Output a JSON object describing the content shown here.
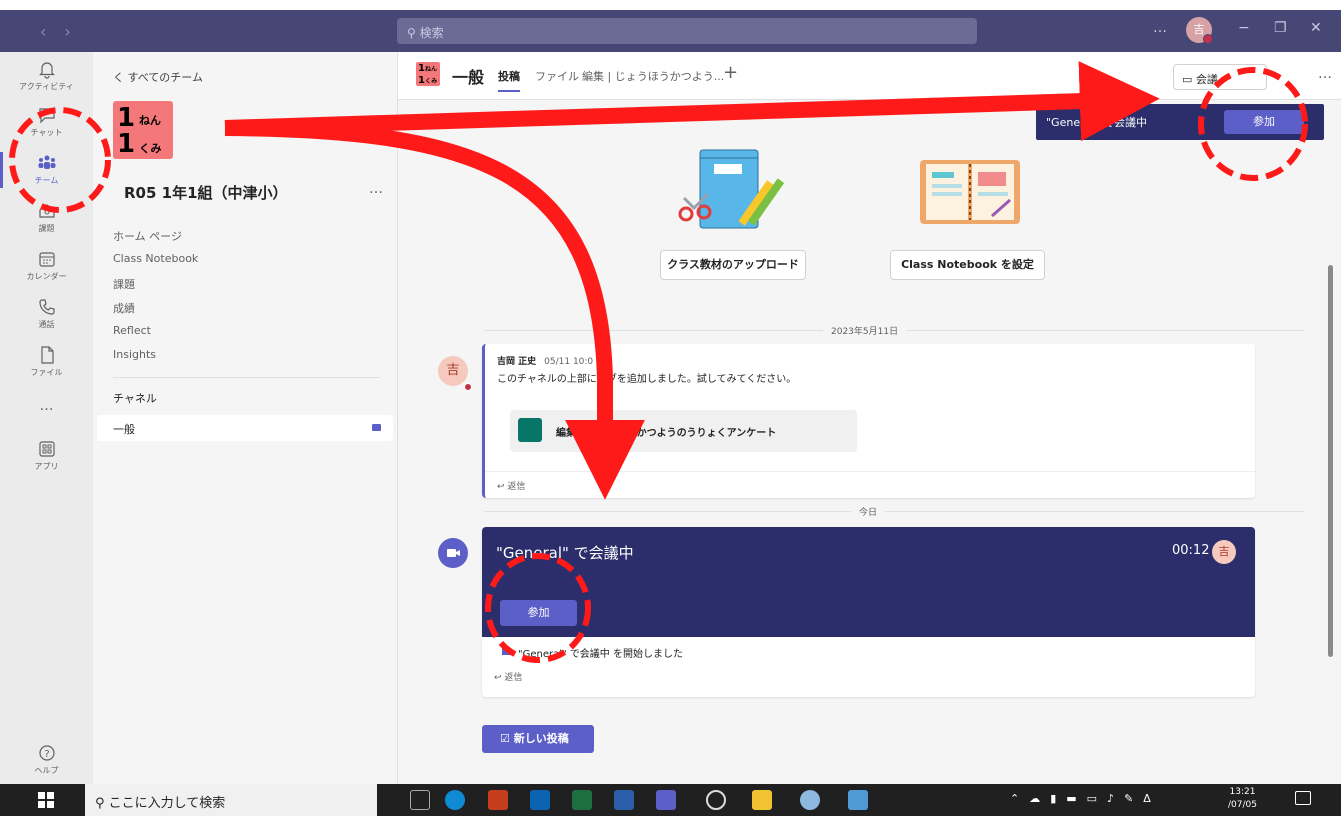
{
  "titlebar": {
    "search_placeholder": "検索",
    "avatar": "吉",
    "more": "…",
    "minimize": "−",
    "restore": "❐",
    "close": "✕"
  },
  "rail": [
    {
      "label": "アクティビティ",
      "icon": "bell-icon"
    },
    {
      "label": "チャット",
      "icon": "chat-icon"
    },
    {
      "label": "チーム",
      "icon": "teams-icon",
      "active": true
    },
    {
      "label": "課題",
      "icon": "assignments-icon"
    },
    {
      "label": "カレンダー",
      "icon": "calendar-icon"
    },
    {
      "label": "通話",
      "icon": "phone-icon"
    },
    {
      "label": "ファイル",
      "icon": "file-icon"
    },
    {
      "label": "…",
      "icon": "more-icon"
    },
    {
      "label": "アプリ",
      "icon": "apps-icon"
    },
    {
      "label": "ヘルプ",
      "icon": "help-icon"
    }
  ],
  "team": {
    "back": "く すべてのチーム",
    "logo": {
      "l1": "1",
      "s1": "ねん",
      "l2": "1",
      "s2": "くみ"
    },
    "name": "R05 1年1組（中津小）",
    "more": "…",
    "links": [
      "ホーム ページ",
      "Class Notebook",
      "課題",
      "成績",
      "Reflect",
      "Insights"
    ],
    "channels_header": "チャネル",
    "channel": "一般"
  },
  "channel": {
    "logo": "1ねん\n1くみ",
    "name": "一般",
    "tabs": [
      "投稿",
      "ファイル",
      "編集 | じょうほうかつよう..."
    ],
    "add_tab": "+",
    "meet_label": "会議",
    "more": "…"
  },
  "banner": {
    "text": "\"General\" で会議中",
    "join": "参加"
  },
  "actions": {
    "upload": "クラス教材のアップロード",
    "notebook": "Class Notebook を設定"
  },
  "dates": {
    "d1": "2023年5月11日",
    "d2": "今日"
  },
  "post1": {
    "avatar": "吉",
    "author": "吉岡 正史",
    "time": "05/11 10:0",
    "message": "このチャネルの上部にタブを追加しました。試してみてください。",
    "card": "編集 | じょうほうかつようのうりょくアンケート",
    "reply": "↩ 返信"
  },
  "post2": {
    "title": "\"General\" で会議中",
    "time": "00:12",
    "avatar": "吉",
    "join": "参加",
    "note": "\"General\" で会議中 を開始しました",
    "reply": "↩ 返信"
  },
  "newpost": "新しい投稿",
  "taskbar": {
    "search": "ここに入力して検索",
    "time": "13:21",
    "date": "/07/05"
  },
  "colors": {
    "brand": "#464775",
    "accent": "#5b5fc7",
    "meeting": "#2b2e6b",
    "annotation": "#ff0000"
  }
}
